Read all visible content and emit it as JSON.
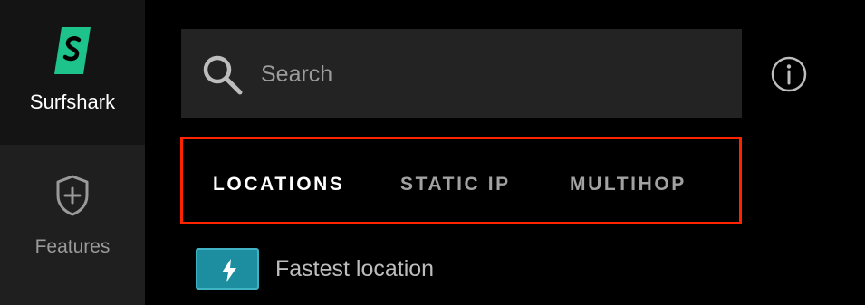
{
  "sidebar": {
    "brand": {
      "label": "Surfshark",
      "icon": "surfshark-logo-icon"
    },
    "features": {
      "label": "Features",
      "icon": "shield-plus-icon"
    }
  },
  "search": {
    "placeholder": "Search",
    "value": "",
    "icon": "search-icon"
  },
  "info": {
    "icon": "info-icon"
  },
  "tabs": [
    {
      "label": "LOCATIONS",
      "active": true
    },
    {
      "label": "STATIC IP",
      "active": false
    },
    {
      "label": "MULTIHOP",
      "active": false
    }
  ],
  "fastest": {
    "label": "Fastest location",
    "icon": "lightning-icon"
  },
  "colors": {
    "brand_green": "#1ec28b",
    "highlight_red": "#ff2400",
    "accent_teal": "#1d8ea0",
    "background": "#000000",
    "sidebar": "#1f1f1f"
  }
}
